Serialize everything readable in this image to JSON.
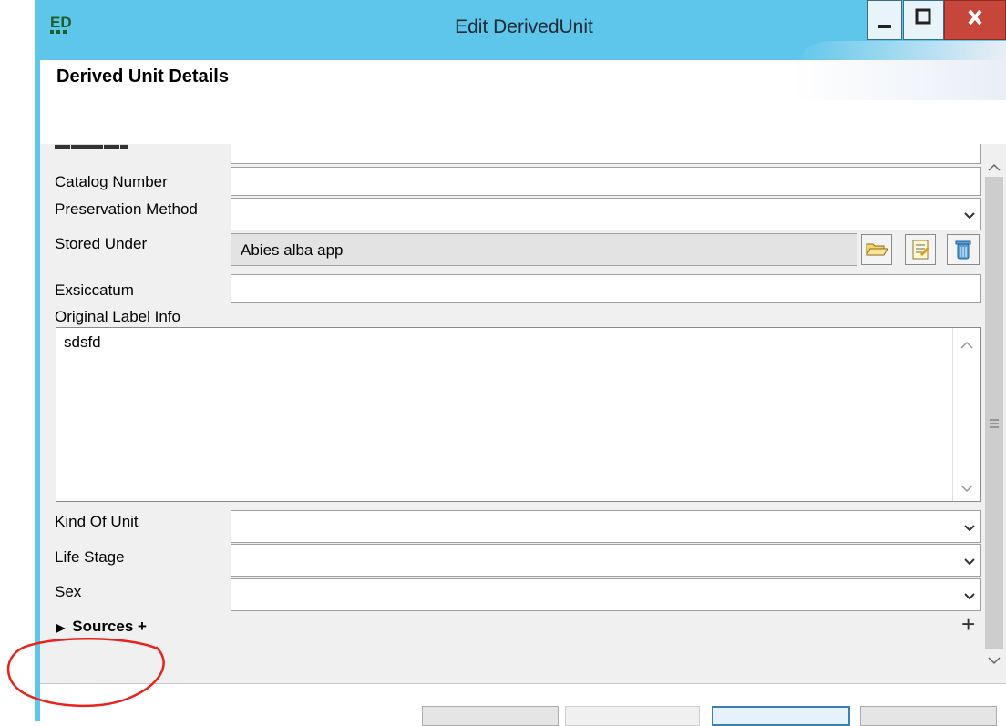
{
  "window": {
    "title": "Edit DerivedUnit",
    "accent": "#5ec6ea",
    "close_color": "#c7463c",
    "icons": {
      "app": "ed-app-icon",
      "minimize": "minimize-icon",
      "maximize": "maximize-icon",
      "close": "close-icon"
    }
  },
  "header": {
    "title": "Derived Unit Details"
  },
  "form": {
    "catalog_number": {
      "label": "Catalog Number",
      "value": ""
    },
    "preservation_method": {
      "label": "Preservation Method",
      "value": ""
    },
    "stored_under": {
      "label": "Stored Under",
      "value": "Abies alba app"
    },
    "exsiccatum": {
      "label": "Exsiccatum",
      "value": ""
    },
    "original_label_info": {
      "label": "Original Label Info",
      "value": "sdsfd"
    },
    "kind_of_unit": {
      "label": "Kind Of Unit",
      "value": ""
    },
    "life_stage": {
      "label": "Life Stage",
      "value": ""
    },
    "sex": {
      "label": "Sex",
      "value": ""
    }
  },
  "sources": {
    "label": "Sources +",
    "add_symbol": "+"
  },
  "annotation": {
    "color": "#e8221c",
    "shape": "red-circle-annotation"
  }
}
